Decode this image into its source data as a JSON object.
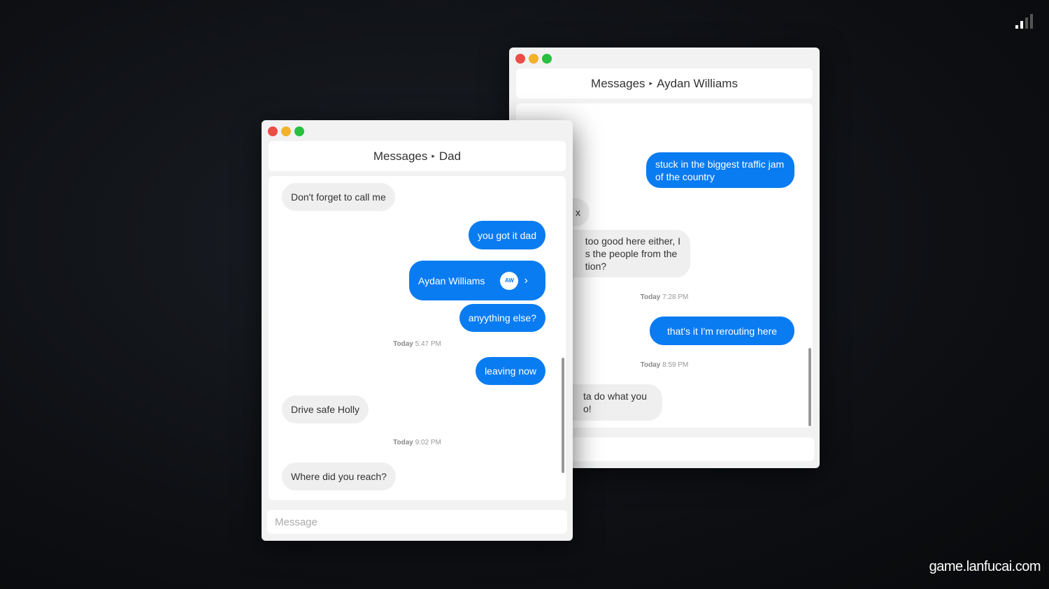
{
  "colors": {
    "accent": "#0a7cf2",
    "close": "#ec4d46",
    "minimize": "#f2b22c",
    "maximize": "#27c03f"
  },
  "back_window": {
    "app": "Messages",
    "contact": "Aydan Williams",
    "messages": [
      {
        "dir": "out",
        "text": "stuck in the biggest traffic jam of the country"
      },
      {
        "dir": "in",
        "text": "x"
      },
      {
        "dir": "in",
        "text": "too good here either, I\ns the people from the\ntion?"
      },
      {
        "ts_day": "Today",
        "ts_time": "7:28 PM"
      },
      {
        "dir": "out",
        "text": "that's it I'm rerouting here"
      },
      {
        "ts_day": "Today",
        "ts_time": "8:59 PM"
      },
      {
        "dir": "in",
        "text": "ta do what you\no!"
      }
    ]
  },
  "front_window": {
    "app": "Messages",
    "contact": "Dad",
    "messages": [
      {
        "dir": "in",
        "text": "Don't forget to call me"
      },
      {
        "dir": "out",
        "text": "you got it dad"
      },
      {
        "dir": "out",
        "contact_card": "Aydan Williams",
        "initials": "AW"
      },
      {
        "dir": "out",
        "text": "anyything else?"
      },
      {
        "ts_day": "Today",
        "ts_time": "5:47 PM"
      },
      {
        "dir": "out",
        "text": "leaving now"
      },
      {
        "dir": "in",
        "text": "Drive safe Holly"
      },
      {
        "ts_day": "Today",
        "ts_time": "9:02 PM"
      },
      {
        "dir": "in",
        "text": "Where did you reach?"
      }
    ],
    "input_placeholder": "Message"
  },
  "watermark": "game.lanfucai.com",
  "icons": {
    "signal": "signal-bars-icon",
    "chevron": "chevron-right-icon"
  }
}
